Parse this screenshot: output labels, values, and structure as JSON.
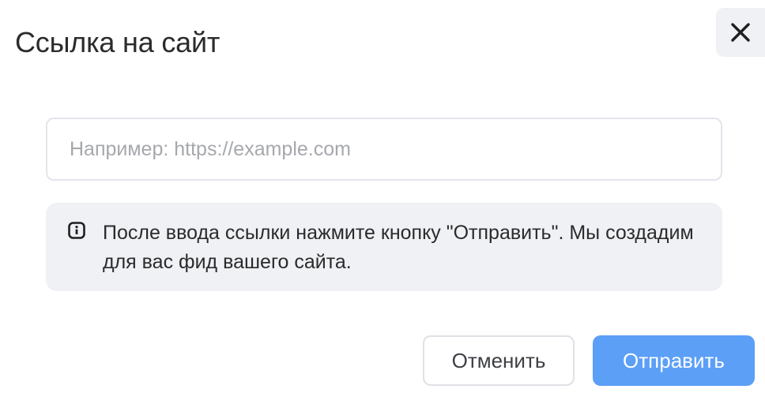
{
  "dialog": {
    "title": "Ссылка на сайт",
    "close_icon": "close-icon"
  },
  "url_input": {
    "value": "",
    "placeholder": "Например: https://example.com"
  },
  "info": {
    "icon": "info-icon",
    "text": "После ввода ссылки нажмите кнопку \"Отправить\". Мы создадим для вас фид вашего сайта."
  },
  "buttons": {
    "cancel_label": "Отменить",
    "submit_label": "Отправить"
  },
  "colors": {
    "accent": "#5c9ff7",
    "info_background": "#f0f1f5",
    "text": "#2b2b2b",
    "placeholder": "#a6a8ad"
  }
}
